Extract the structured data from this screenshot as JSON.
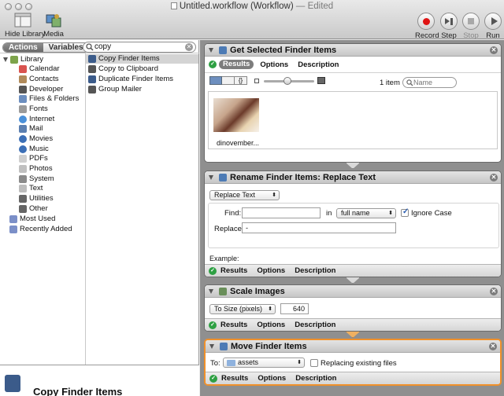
{
  "window": {
    "title": "Untitled.workflow",
    "subtitle": "(Workflow)",
    "status": "— Edited"
  },
  "toolbar": {
    "hide_library": "Hide Library",
    "media": "Media",
    "record": "Record",
    "step": "Step",
    "stop": "Stop",
    "run": "Run"
  },
  "library": {
    "tabs": {
      "actions": "Actions",
      "variables": "Variables"
    },
    "search_value": "copy",
    "tree": [
      {
        "label": "Library",
        "color": "#7da34b"
      },
      {
        "label": "Calendar",
        "color": "#d9534f"
      },
      {
        "label": "Contacts",
        "color": "#b08a5a"
      },
      {
        "label": "Developer",
        "color": "#555555"
      },
      {
        "label": "Files & Folders",
        "color": "#6c8ebf"
      },
      {
        "label": "Fonts",
        "color": "#9a9a9a"
      },
      {
        "label": "Internet",
        "color": "#4a90d9"
      },
      {
        "label": "Mail",
        "color": "#5b7fb0"
      },
      {
        "label": "Movies",
        "color": "#3c6fb6"
      },
      {
        "label": "Music",
        "color": "#3c6fb6"
      },
      {
        "label": "PDFs",
        "color": "#cfcfcf"
      },
      {
        "label": "Photos",
        "color": "#c0c0c0"
      },
      {
        "label": "System",
        "color": "#8a8a8a"
      },
      {
        "label": "Text",
        "color": "#bdbdbd"
      },
      {
        "label": "Utilities",
        "color": "#666666"
      },
      {
        "label": "Other",
        "color": "#666666"
      },
      {
        "label": "Most Used",
        "color": "#7b8fc8"
      },
      {
        "label": "Recently Added",
        "color": "#7b8fc8"
      }
    ],
    "results": [
      "Copy Finder Items",
      "Copy to Clipboard",
      "Duplicate Finder Items",
      "Group Mailer"
    ],
    "description_title": "Copy Finder Items"
  },
  "workflow": {
    "get_items": {
      "title": "Get Selected Finder Items",
      "tabs": {
        "results": "Results",
        "options": "Options",
        "description": "Description"
      },
      "count": "1 item",
      "search_placeholder": "Name",
      "file_name": "dinovember..."
    },
    "rename": {
      "title": "Rename Finder Items: Replace Text",
      "mode": "Replace Text",
      "find_label": "Find:",
      "in_label": "in",
      "in_value": "full name",
      "ignore_case": "Ignore Case",
      "replace_label": "Replace:",
      "replace_value": "-",
      "example_label": "Example:",
      "footer": {
        "results": "Results",
        "options": "Options",
        "description": "Description"
      }
    },
    "scale": {
      "title": "Scale Images",
      "mode": "To Size (pixels)",
      "size": "640",
      "footer": {
        "results": "Results",
        "options": "Options",
        "description": "Description"
      }
    },
    "move": {
      "title": "Move Finder Items",
      "to_label": "To:",
      "to_value": "assets",
      "replacing": "Replacing existing files",
      "footer": {
        "results": "Results",
        "options": "Options",
        "description": "Description"
      }
    }
  }
}
